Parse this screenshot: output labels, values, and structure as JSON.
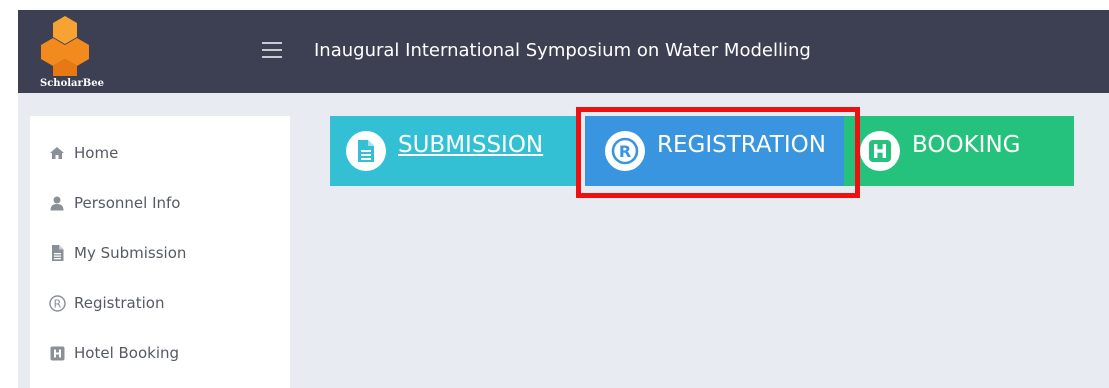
{
  "header": {
    "logo_text": "ScholarBee",
    "title": "Inaugural International Symposium on Water Modelling",
    "menu_icon": "hamburger-icon"
  },
  "sidebar": {
    "items": [
      {
        "label": "Home",
        "icon": "home-icon"
      },
      {
        "label": "Personnel Info",
        "icon": "user-icon"
      },
      {
        "label": "My Submission",
        "icon": "document-icon"
      },
      {
        "label": "Registration",
        "icon": "registered-icon"
      },
      {
        "label": "Hotel Booking",
        "icon": "hotel-icon"
      }
    ]
  },
  "tiles": [
    {
      "label": "SUBMISSION",
      "icon": "document-icon",
      "color": "#33c0d4"
    },
    {
      "label": "REGISTRATION",
      "icon": "registered-icon",
      "color": "#3a95e0"
    },
    {
      "label": "BOOKING",
      "icon": "hotel-icon",
      "color": "#24c27d"
    }
  ],
  "colors": {
    "topbar": "#3d4052",
    "content_bg": "#e9ebf2",
    "highlight": "#ee1111",
    "logo_orange": "#f28a1d"
  }
}
